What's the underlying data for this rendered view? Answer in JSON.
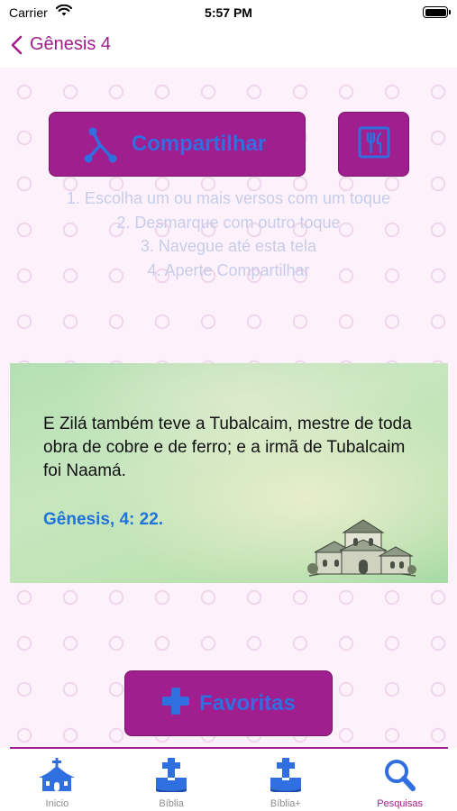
{
  "status_bar": {
    "carrier": "Carrier",
    "time": "5:57 PM"
  },
  "nav": {
    "back_label": "Gênesis 4"
  },
  "actions": {
    "share_label": "Compartilhar",
    "favorites_label": "Favoritas"
  },
  "instructions": [
    "1. Escolha um ou mais versos com um toque",
    "2. Desmarque com outro toque",
    "3. Navegue até esta tela",
    "4. Aperte Compartilhar"
  ],
  "verse": {
    "text": "E Zilá também teve a Tubalcaim, mestre de toda obra de cobre e de ferro; e a irmã de Tubalcaim foi Naamá.",
    "reference": "Gênesis, 4: 22."
  },
  "tabs": [
    {
      "label": "Inicio",
      "icon": "church-icon",
      "active": false
    },
    {
      "label": "Bíblia",
      "icon": "bible-icon",
      "active": false
    },
    {
      "label": "Bíblia+",
      "icon": "bible-plus-icon",
      "active": false
    },
    {
      "label": "Pesquisas",
      "icon": "search-icon",
      "active": true
    }
  ],
  "colors": {
    "accent": "#a01e8e",
    "button_text": "#2f6fe0",
    "reference": "#1f73d9",
    "instructions": "#c7cde9"
  }
}
